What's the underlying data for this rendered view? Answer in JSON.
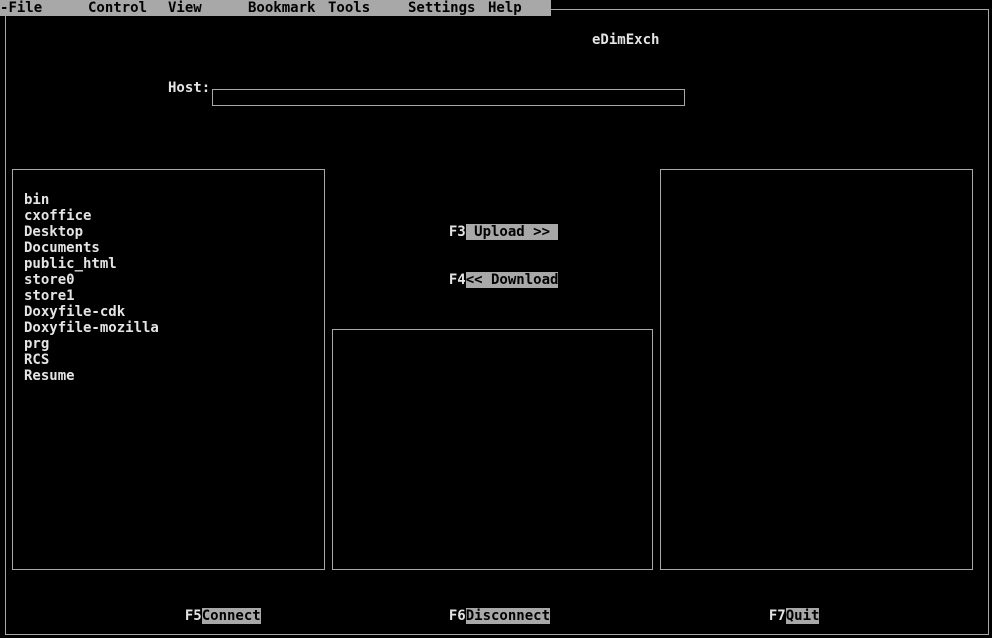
{
  "menu": {
    "items": [
      {
        "label": "File"
      },
      {
        "label": "Control"
      },
      {
        "label": "View"
      },
      {
        "label": "Bookmark"
      },
      {
        "label": "Tools"
      },
      {
        "label": "Settings"
      },
      {
        "label": "Help"
      }
    ]
  },
  "window": {
    "title": "eDimExch"
  },
  "host": {
    "label": "Host:",
    "value": ""
  },
  "local_files": [
    "bin",
    "cxoffice",
    "Desktop",
    "Documents",
    "public_html",
    "store0",
    "store1",
    "Doxyfile-cdk",
    "Doxyfile-mozilla",
    "prg",
    "RCS",
    "Resume"
  ],
  "buttons": {
    "upload": {
      "key": "F3",
      "label": " Upload >> "
    },
    "download": {
      "key": "F4",
      "label": "<< Download"
    },
    "connect": {
      "key": "F5",
      "label": "Connect"
    },
    "disconnect": {
      "key": "F6",
      "label": "Disconnect"
    },
    "quit": {
      "key": "F7",
      "label": "Quit"
    }
  },
  "colors": {
    "background": "#000000",
    "foreground": "#e4e4e4",
    "highlight": "#a8a8a8"
  }
}
